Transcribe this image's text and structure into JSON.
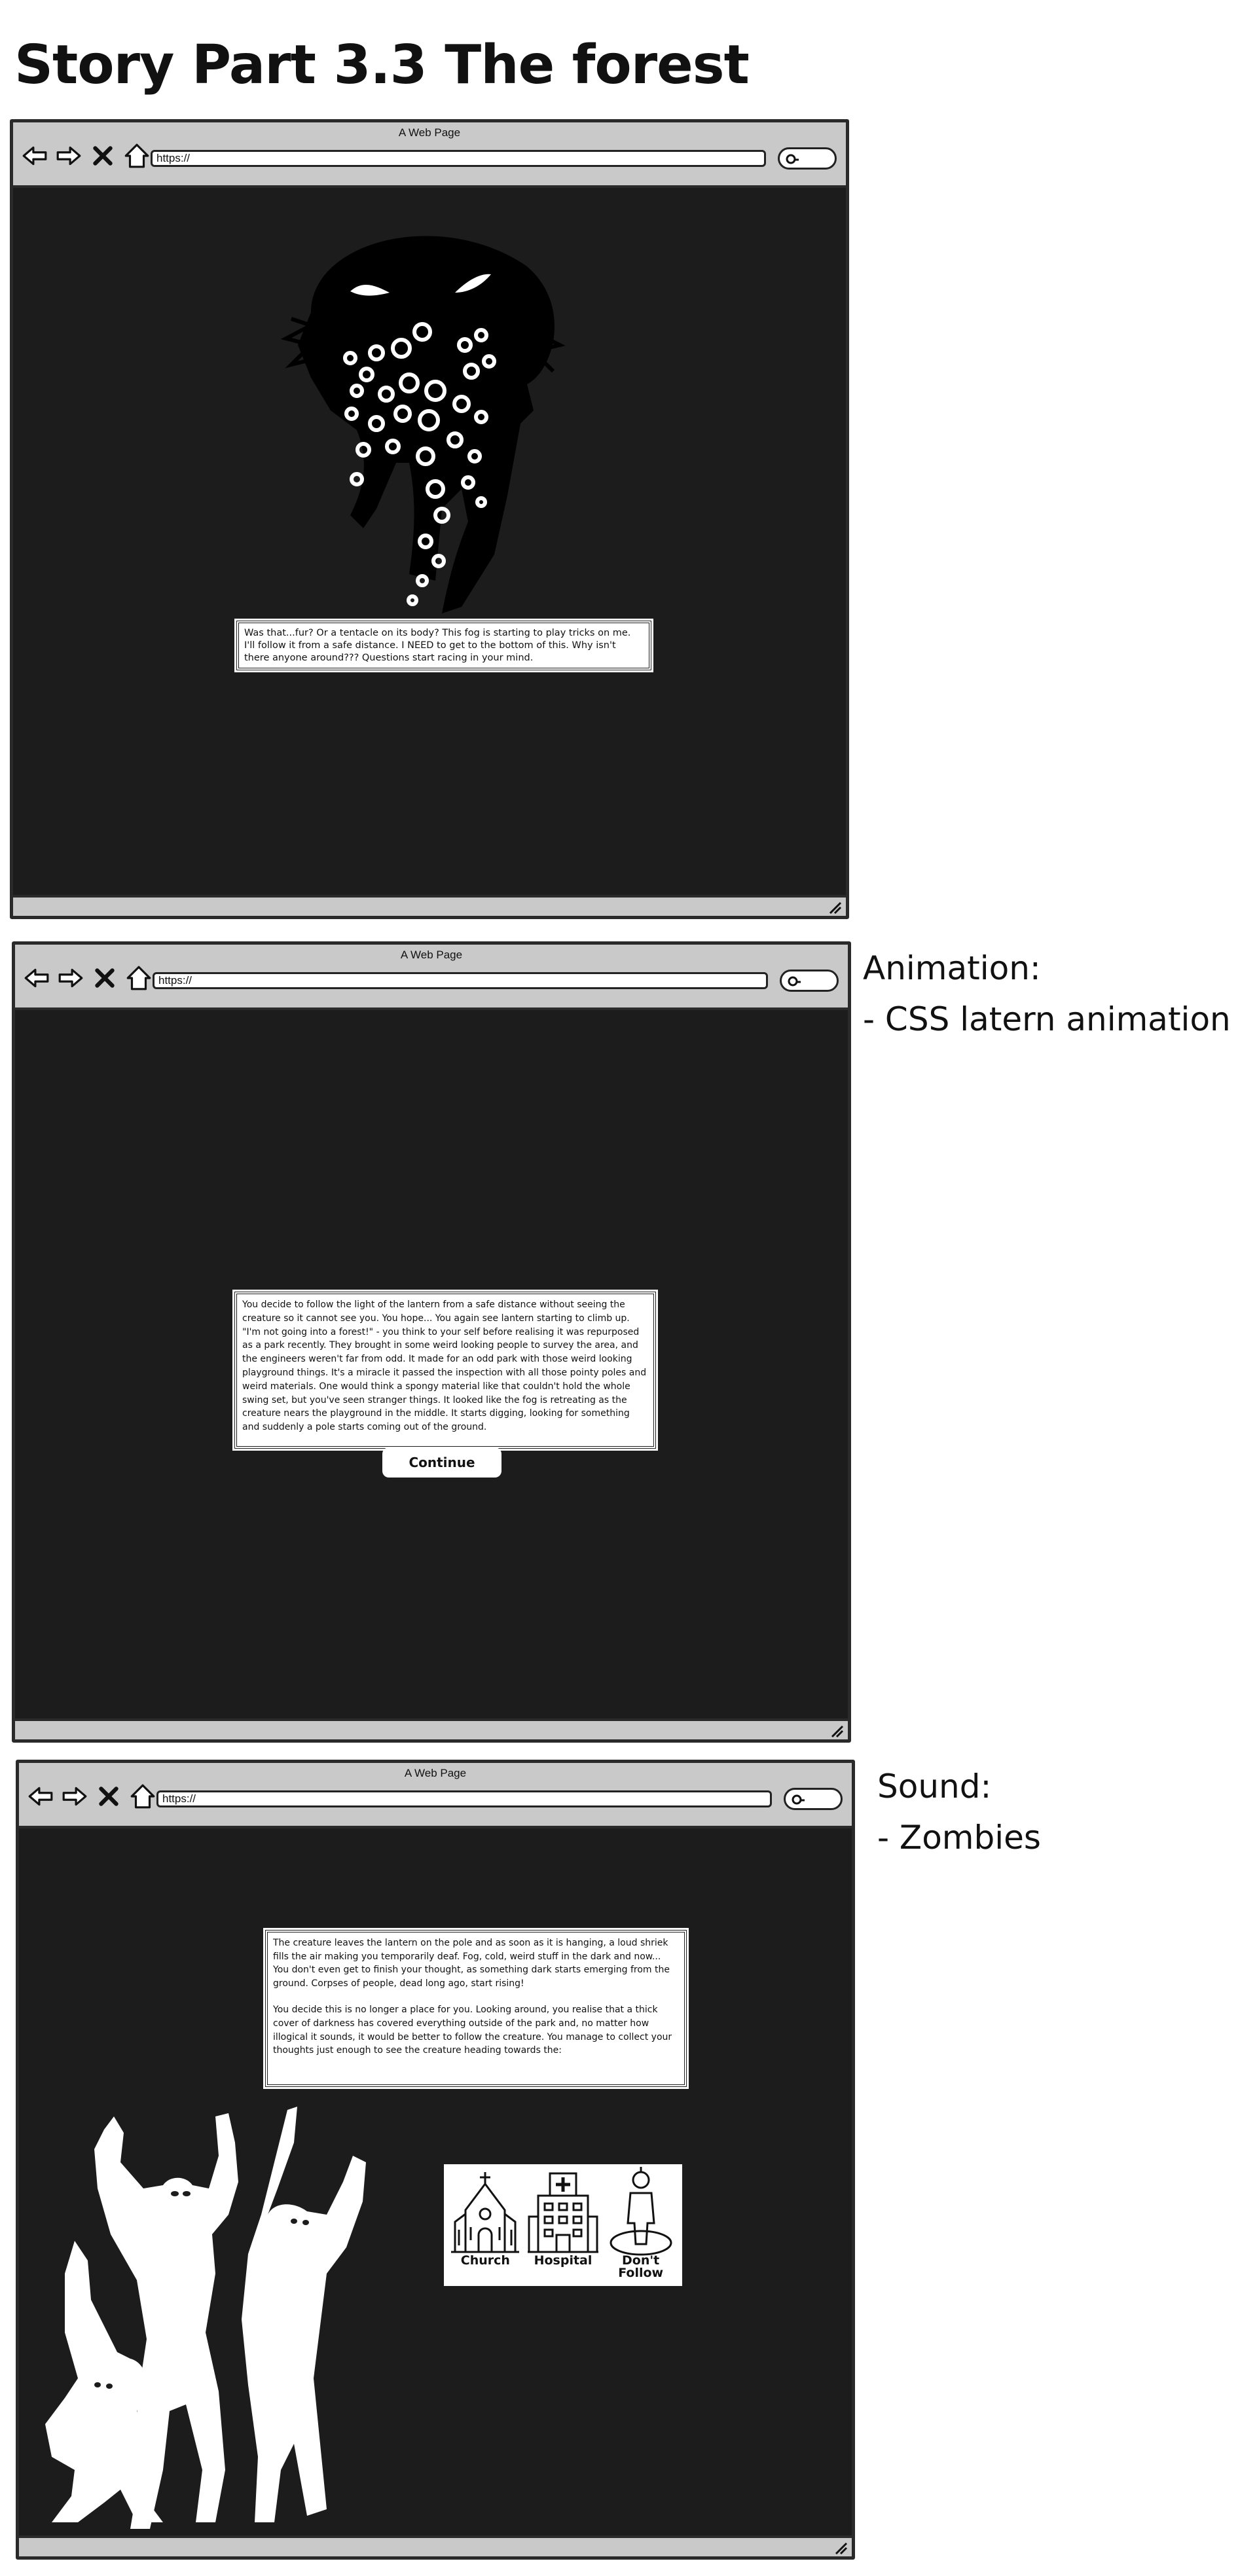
{
  "page": {
    "title": "Story Part 3.3 The forest"
  },
  "browser": {
    "window_title": "A Web Page",
    "url": "https://"
  },
  "screen1": {
    "text": "Was that...fur? Or a tentacle on its body? This fog is starting to play tricks on me. I'll follow it from a safe distance. I NEED to get to the bottom of this. Why isn't there anyone around??? Questions start racing in your mind."
  },
  "screen2": {
    "text": "You decide to follow the light of the lantern from a safe distance without seeing the creature so it cannot see you. You hope... You again see lantern starting to climb up. \"I'm not going into a forest!\" - you think to your self before realising it was repurposed as a park recently. They brought in some weird looking people to survey the area, and the engineers weren't far from odd. It made for an odd park with those weird looking playground things. It's a miracle it passed the inspection with all those pointy poles and weird materials. One would think a spongy material like that couldn't hold the whole swing set, but you've seen stranger things. It looked like the fog is retreating as the creature nears the playground in the middle. It starts digging, looking for something and suddenly a pole starts coming out of the ground.",
    "continue_label": "Continue",
    "notes_heading": "Animation:",
    "notes_item": "- CSS latern animation"
  },
  "screen3": {
    "paragraph1": "The creature leaves the lantern on the pole and as soon as it is hanging, a loud shriek fills the air making you temporarily deaf. Fog, cold, weird stuff in the dark and now... You don't even get to finish your thought, as something dark starts emerging from the ground. Corpses of people, dead long ago, start rising!",
    "paragraph2": "You decide this is no longer a place for you. Looking around, you realise that a thick cover of darkness has covered everything outside of the park and, no matter how illogical it sounds, it would be better to follow the creature. You manage to collect your thoughts just enough to see the creature heading towards the:",
    "choices": [
      {
        "label": "Church",
        "icon": "church-icon"
      },
      {
        "label": "Hospital",
        "icon": "hospital-icon"
      },
      {
        "label": "Don't Follow",
        "icon": "person-icon"
      }
    ],
    "notes_heading": "Sound:",
    "notes_item": "- Zombies"
  }
}
